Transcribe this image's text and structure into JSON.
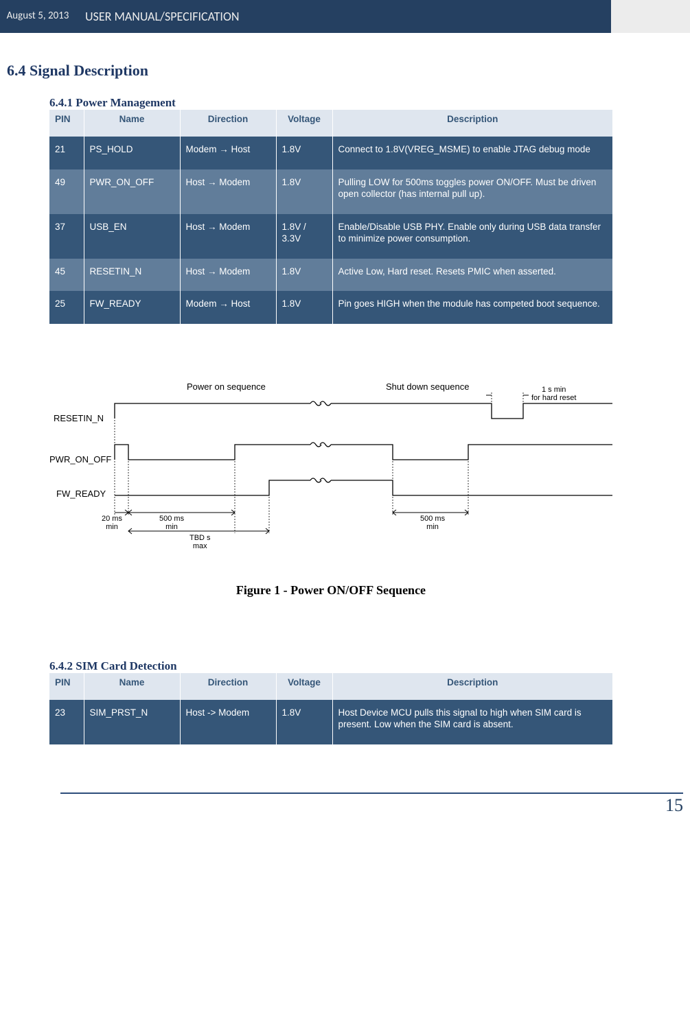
{
  "header": {
    "date": "August 5, 2013",
    "title": "USER MANUAL/SPECIFICATION"
  },
  "section": {
    "h2": "6.4 Signal Description",
    "h3_1": "6.4.1 Power Management",
    "h3_2": "6.4.2 SIM Card Detection"
  },
  "table_headers": {
    "pin": "PIN",
    "name": "Name",
    "direction": "Direction",
    "voltage": "Voltage",
    "description": "Description"
  },
  "table1": [
    {
      "pin": "21",
      "name": "PS_HOLD",
      "dir": "Modem → Host",
      "volt": "1.8V",
      "desc": "Connect to 1.8V(VREG_MSME) to enable  JTAG debug mode"
    },
    {
      "pin": "49",
      "name": "PWR_ON_OFF",
      "dir": "Host → Modem",
      "volt": "1.8V",
      "desc": "Pulling LOW for 500ms toggles power ON/OFF. Must be driven open collector (has internal pull up)."
    },
    {
      "pin": "37",
      "name": "USB_EN",
      "dir": "Host → Modem",
      "volt": "1.8V / 3.3V",
      "desc": "Enable/Disable USB PHY.  Enable only during USB data transfer to minimize power consumption."
    },
    {
      "pin": "45",
      "name": "RESETIN_N",
      "dir": "Host → Modem",
      "volt": "1.8V",
      "desc": "Active Low, Hard reset.  Resets PMIC when asserted."
    },
    {
      "pin": "25",
      "name": "FW_READY",
      "dir": "Modem → Host",
      "volt": "1.8V",
      "desc": "Pin goes HIGH when the module has competed boot sequence."
    }
  ],
  "diagram": {
    "power_on": "Power on sequence",
    "shutdown": "Shut down sequence",
    "hard_reset": "1 s min\nfor hard reset",
    "sig_resetin": "RESETIN_N",
    "sig_pwronoff": "PWR_ON_OFF",
    "sig_fwready": "FW_READY",
    "t_20ms": "20 ms\nmin",
    "t_500ms": "500 ms\nmin",
    "t_tbd": "TBD s\nmax",
    "t_500ms_b": "500 ms\nmin"
  },
  "caption": "Figure 1 - Power ON/OFF Sequence",
  "table2": [
    {
      "pin": "23",
      "name": "SIM_PRST_N",
      "dir": "Host -> Modem",
      "volt": "1.8V",
      "desc": "Host Device MCU pulls this signal to high when SIM card is present.  Low when the SIM card is absent."
    }
  ],
  "page_number": "15"
}
